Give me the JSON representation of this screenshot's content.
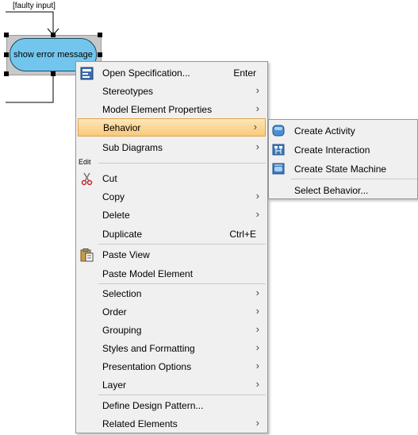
{
  "diagram": {
    "guard_label": "[faulty input]",
    "action_label": "show error message"
  },
  "menu": {
    "items": [
      {
        "label": "Open Specification...",
        "shortcut": "Enter"
      },
      {
        "label": "Stereotypes"
      },
      {
        "label": "Model Element Properties"
      },
      {
        "label": "Behavior"
      },
      {
        "label": "Sub Diagrams"
      },
      {
        "label": "Cut"
      },
      {
        "label": "Copy"
      },
      {
        "label": "Delete"
      },
      {
        "label": "Duplicate",
        "shortcut": "Ctrl+E"
      },
      {
        "label": "Paste View"
      },
      {
        "label": "Paste Model Element"
      },
      {
        "label": "Selection"
      },
      {
        "label": "Order"
      },
      {
        "label": "Grouping"
      },
      {
        "label": "Styles and Formatting"
      },
      {
        "label": "Presentation Options"
      },
      {
        "label": "Layer"
      },
      {
        "label": "Define Design Pattern..."
      },
      {
        "label": "Related Elements"
      }
    ],
    "group_edit": "Edit",
    "submenu_arrow": "›"
  },
  "submenu": {
    "items": [
      {
        "label": "Create Activity"
      },
      {
        "label": "Create Interaction"
      },
      {
        "label": "Create State Machine"
      },
      {
        "label": "Select Behavior..."
      }
    ]
  },
  "colors": {
    "highlight": "#f9c97a",
    "action_fill": "#72c6ee"
  }
}
